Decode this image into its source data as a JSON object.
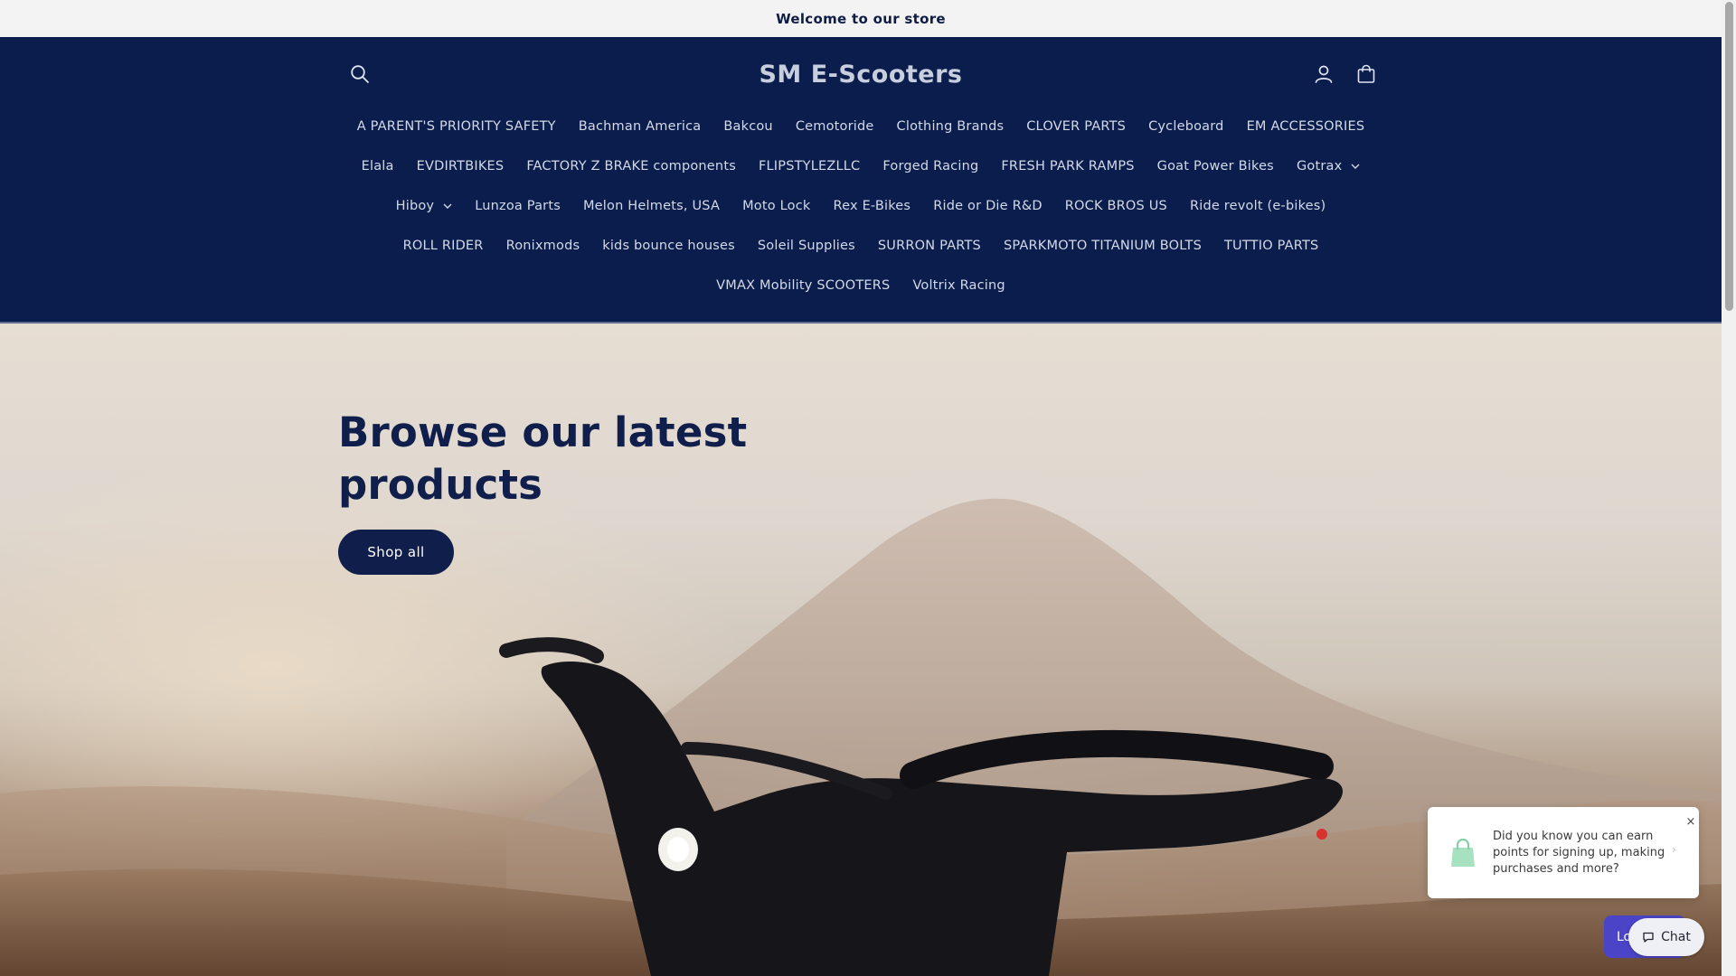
{
  "announcement": {
    "text": "Welcome to our store"
  },
  "header": {
    "brand": "SM E-Scooters",
    "icons": {
      "search": "search-icon",
      "account": "account-icon",
      "cart": "cart-icon"
    }
  },
  "nav": {
    "items": [
      {
        "label": "A PARENT'S PRIORITY SAFETY"
      },
      {
        "label": "Bachman America"
      },
      {
        "label": "Bakcou"
      },
      {
        "label": "Cemotoride"
      },
      {
        "label": "Clothing Brands"
      },
      {
        "label": "CLOVER PARTS"
      },
      {
        "label": "Cycleboard"
      },
      {
        "label": "EM ACCESSORIES"
      },
      {
        "label": "Elala"
      },
      {
        "label": "EVDIRTBIKES"
      },
      {
        "label": "FACTORY Z BRAKE components"
      },
      {
        "label": "FLIPSTYLEZLLC"
      },
      {
        "label": "Forged Racing"
      },
      {
        "label": "FRESH PARK RAMPS"
      },
      {
        "label": "Goat Power Bikes"
      },
      {
        "label": "Gotrax"
      },
      {
        "label": "Hiboy"
      },
      {
        "label": "Lunzoa Parts"
      },
      {
        "label": "Melon Helmets, USA"
      },
      {
        "label": "Moto Lock"
      },
      {
        "label": "Rex E-Bikes"
      },
      {
        "label": "Ride or Die R&D"
      },
      {
        "label": "ROCK BROS US"
      },
      {
        "label": "Ride revolt (e-bikes)"
      },
      {
        "label": "ROLL RIDER"
      },
      {
        "label": "Ronixmods"
      },
      {
        "label": "kids bounce houses"
      },
      {
        "label": "Soleil Supplies"
      },
      {
        "label": "SURRON PARTS"
      },
      {
        "label": "SPARKMOTO TITANIUM BOLTS"
      },
      {
        "label": "TUTTIO PARTS"
      },
      {
        "label": "VMAX Mobility SCOOTERS"
      },
      {
        "label": "Voltrix Racing"
      }
    ]
  },
  "hero": {
    "title": "Browse our latest products",
    "button_label": "Shop all"
  },
  "loyalty": {
    "popup_text": "Did you know you can earn points for signing up, making purchases and more?",
    "close_glyph": "×",
    "launcher_label": "Lo"
  },
  "chat": {
    "label": "Chat"
  },
  "colors": {
    "header_bg": "#0b1d4d",
    "primary_text": "#0f1e4a",
    "announcement_bg": "#f3f3f3",
    "loyalty_purple": "#4b44c7"
  }
}
